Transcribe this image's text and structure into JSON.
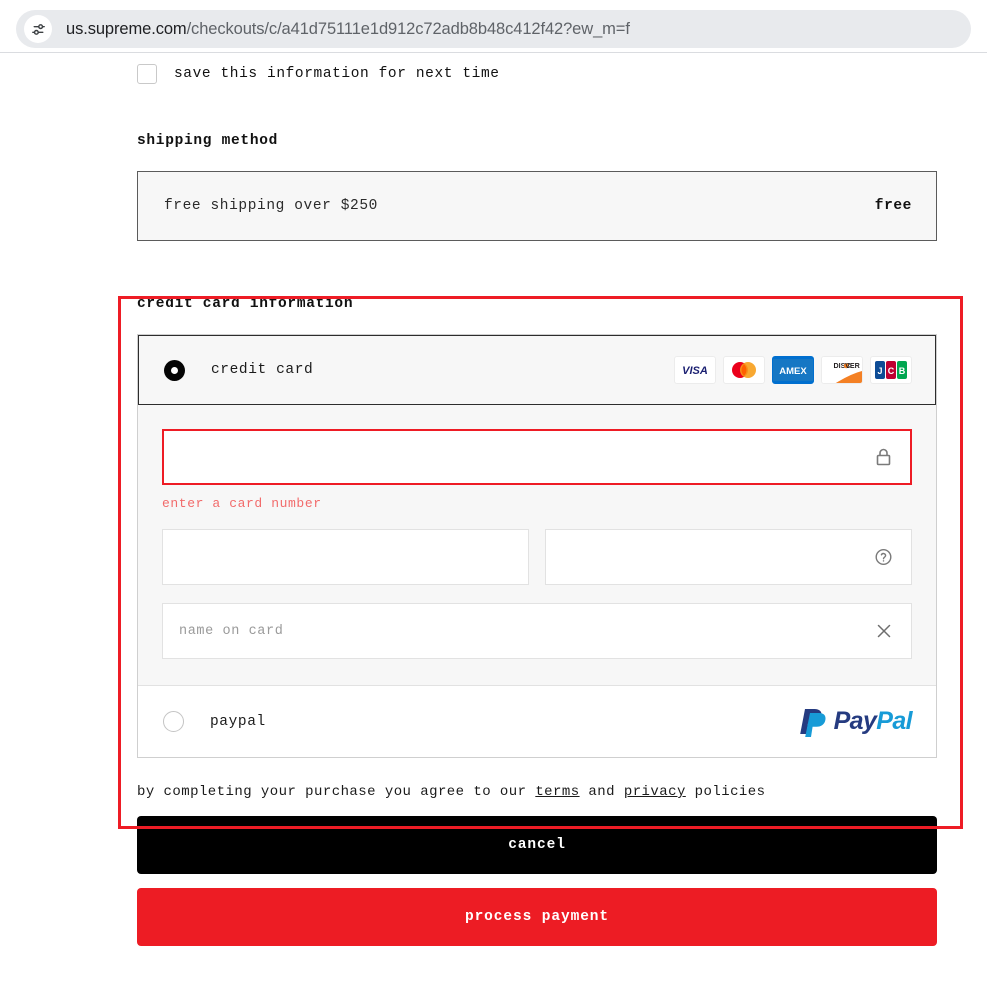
{
  "browser": {
    "site_settings_icon": "tune-sliders-icon",
    "url_host": "us.supreme.com",
    "url_path": "/checkouts/c/a41d75111e1d912c72adb8b48c412f42?ew_m=f",
    "url_full": "us.supreme.com/checkouts/c/a41d75111e1d912c72adb8b48c412f42?ew_m=f"
  },
  "checkout": {
    "save_info": {
      "label": "save this information for next time",
      "checked": false
    },
    "shipping": {
      "heading": "shipping method",
      "option_name": "free shipping over $250",
      "option_price": "free"
    },
    "payment": {
      "heading": "credit card information",
      "methods": [
        {
          "id": "credit-card",
          "label": "credit card",
          "selected": true,
          "brands": [
            "VISA",
            "Mastercard",
            "AMEX",
            "DISCOVER",
            "JCB"
          ]
        },
        {
          "id": "paypal",
          "label": "paypal",
          "selected": false,
          "logo_pay": "Pay",
          "logo_pal": "Pal"
        }
      ],
      "fields": {
        "card_number": {
          "name": "card-number-input",
          "value": "",
          "placeholder": "",
          "icon": "lock-icon",
          "has_error": true,
          "error_text": "enter a card number"
        },
        "expiration": {
          "name": "expiration-date-input",
          "value": "",
          "placeholder": ""
        },
        "security_code": {
          "name": "security-code-input",
          "value": "",
          "placeholder": "",
          "icon": "question-mark-icon"
        },
        "name_on_card": {
          "name": "name-on-card-input",
          "value": "",
          "placeholder": "name on card",
          "icon": "close-x-icon"
        }
      }
    },
    "terms": {
      "prefix": "by completing your purchase you agree to our ",
      "terms_link": "terms",
      "middle": " and ",
      "privacy_link": "privacy",
      "suffix": " policies"
    },
    "actions": {
      "cancel_label": "cancel",
      "process_label": "process payment"
    }
  },
  "colors": {
    "accent_red": "#ed1c24",
    "annotation_red": "#ee1c25",
    "error_text": "#f26b6b",
    "black": "#000000",
    "panel_bg": "#f7f7f7",
    "paypal_dark": "#253b80",
    "paypal_light": "#179bd7"
  }
}
